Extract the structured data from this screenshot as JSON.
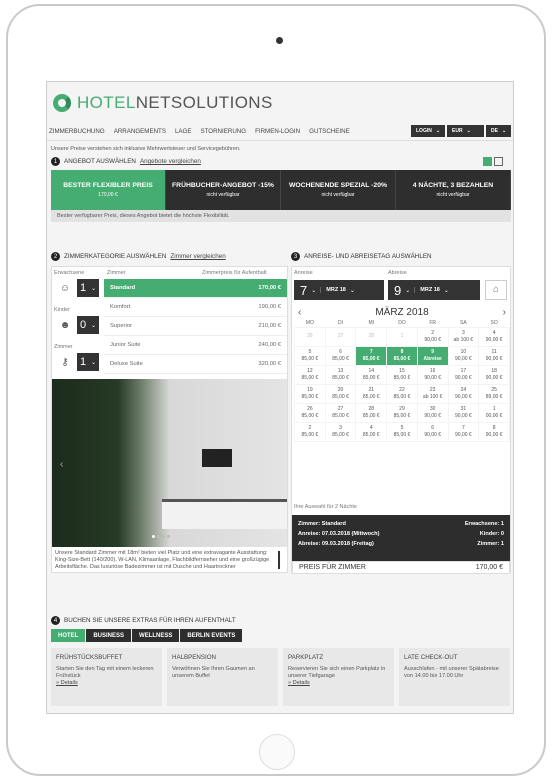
{
  "brand": {
    "part1": "HOTEL",
    "part2": "NETSOLUTIONS"
  },
  "nav": [
    "ZIMMERBUCHUNG",
    "ARRANGEMENTS",
    "LAGE",
    "STORNIERUNG",
    "FIRMEN-LOGIN",
    "GUTSCHEINE"
  ],
  "nav_right": [
    {
      "label": "LOGIN"
    },
    {
      "label": "EUR"
    },
    {
      "label": "DE"
    }
  ],
  "info": "Unsere Preise verstehen sich inklusive Mehrwertsteuer und Servicegebühren.",
  "step1": {
    "n": "1",
    "title": "ANGEBOT AUSWÄHLEN",
    "link": "Angebote vergleichen"
  },
  "offers": [
    {
      "title": "BESTER FLEXIBLER PREIS",
      "sub": "170,00 €"
    },
    {
      "title": "FRÜHBUCHER-ANGEBOT -15%",
      "sub": "nicht verfügbar"
    },
    {
      "title": "WOCHENENDE SPEZIAL -20%",
      "sub": "nicht verfügbar"
    },
    {
      "title": "4 NÄCHTE, 3 BEZAHLEN",
      "sub": "nicht verfügbar"
    }
  ],
  "offer_info": "Bester verfügbarer Preis, dieses Angebot bietet die höchste Flexibilität.",
  "step2": {
    "n": "2",
    "title": "ZIMMERKATEGORIE AUSWÄHLEN",
    "link": "Zimmer vergleichen"
  },
  "counters": {
    "adults_label": "Erwachsene",
    "adults": "1",
    "kids_label": "Kinder",
    "kids": "0",
    "rooms_label": "Zimmer",
    "rooms": "1"
  },
  "room_head": {
    "left": "Zimmer",
    "right": "Zimmerpreis für Aufenthalt"
  },
  "rooms": [
    {
      "name": "Standard",
      "price": "170,00 €"
    },
    {
      "name": "Komfort",
      "price": "190,00 €"
    },
    {
      "name": "Superior",
      "price": "210,00 €"
    },
    {
      "name": "Junior Suite",
      "price": "240,00 €"
    },
    {
      "name": "Deluxe Suite",
      "price": "320,00 €"
    }
  ],
  "room_desc": "Unsere Standard Zimmer mit 18m² bieten viel Platz und eine extravagante Ausstattung: King-Size-Bett (140/200), W-LAN, Klimaanlage, Flachbildfernseher und eine großzügige Arbeitsfläche. Das luxuriöse Badezimmer ist mit Dusche und Haartrockner",
  "step3": {
    "n": "3",
    "title": "ANREISE- UND ABREISETAG AUSWÄHLEN"
  },
  "dates": {
    "arr_label": "Anreise",
    "arr_day": "7",
    "arr_month": "MRZ 18",
    "dep_label": "Abreise",
    "dep_day": "9",
    "dep_month": "MRZ 18"
  },
  "calendar": {
    "prev": "‹",
    "next": "›",
    "month": "MÄRZ 2018",
    "dow": [
      "MO",
      "DI",
      "MI",
      "DO",
      "FR",
      "SA",
      "SO"
    ],
    "weeks": [
      [
        {
          "d": "26",
          "p": ""
        },
        {
          "d": "27",
          "p": ""
        },
        {
          "d": "28",
          "p": ""
        },
        {
          "d": "1",
          "p": ""
        },
        {
          "d": "2",
          "p": "90,00 €"
        },
        {
          "d": "3",
          "p": "ab 100 €"
        },
        {
          "d": "4",
          "p": "90,00 €"
        }
      ],
      [
        {
          "d": "5",
          "p": "85,00 €"
        },
        {
          "d": "6",
          "p": "85,00 €"
        },
        {
          "d": "7",
          "p": "85,00 €"
        },
        {
          "d": "8",
          "p": "85,00 €"
        },
        {
          "d": "9",
          "p": "Abreise"
        },
        {
          "d": "10",
          "p": "90,00 €"
        },
        {
          "d": "11",
          "p": "90,00 €"
        }
      ],
      [
        {
          "d": "12",
          "p": "85,00 €"
        },
        {
          "d": "13",
          "p": "85,00 €"
        },
        {
          "d": "14",
          "p": "85,00 €"
        },
        {
          "d": "15",
          "p": "85,00 €"
        },
        {
          "d": "16",
          "p": "90,00 €"
        },
        {
          "d": "17",
          "p": "90,00 €"
        },
        {
          "d": "18",
          "p": "90,00 €"
        }
      ],
      [
        {
          "d": "19",
          "p": "85,00 €"
        },
        {
          "d": "20",
          "p": "85,00 €"
        },
        {
          "d": "21",
          "p": "85,00 €"
        },
        {
          "d": "22",
          "p": "85,00 €"
        },
        {
          "d": "23",
          "p": "ab 100 €"
        },
        {
          "d": "24",
          "p": "90,00 €"
        },
        {
          "d": "25",
          "p": "89,00 €"
        }
      ],
      [
        {
          "d": "26",
          "p": "85,00 €"
        },
        {
          "d": "27",
          "p": "85,00 €"
        },
        {
          "d": "28",
          "p": "85,00 €"
        },
        {
          "d": "29",
          "p": "85,00 €"
        },
        {
          "d": "30",
          "p": "90,00 €"
        },
        {
          "d": "31",
          "p": "90,00 €"
        },
        {
          "d": "1",
          "p": "00,00 €"
        }
      ],
      [
        {
          "d": "2",
          "p": "85,00 €"
        },
        {
          "d": "3",
          "p": "85,00 €"
        },
        {
          "d": "4",
          "p": "85,00 €"
        },
        {
          "d": "5",
          "p": "85,00 €"
        },
        {
          "d": "6",
          "p": "90,00 €"
        },
        {
          "d": "7",
          "p": "90,00 €"
        },
        {
          "d": "8",
          "p": "90,00 €"
        }
      ]
    ]
  },
  "selection": {
    "label": "Ihre Auswahl für 2 Nächte",
    "zimmer": "Zimmer:  Standard",
    "erw": "Erwachsene: 1",
    "anreise": "Anreise:  07.03.2018 (Mittwoch)",
    "kinder": "Kinder: 0",
    "abreise": "Abreise:  09.03.2018 (Freitag)",
    "zimmer_n": "Zimmer: 1",
    "price_label": "PREIS FÜR ZIMMER",
    "price": "170,00 €"
  },
  "step4": {
    "n": "4",
    "title": "BUCHEN SIE UNSERE EXTRAS FÜR IHREN AUFENTHALT"
  },
  "extra_tabs": [
    "HOTEL",
    "BUSINESS",
    "WELLNESS",
    "BERLIN EVENTS"
  ],
  "extras": [
    {
      "title": "FRÜHSTÜCKSBUFFET",
      "text": "Starten Sie den Tag mit einem leckeren Frühstück",
      "link": "» Details"
    },
    {
      "title": "HALBPENSION",
      "text": "Verwöhnen Sie Ihren Gaumen an unserem Buffet",
      "link": ""
    },
    {
      "title": "PARKPLATZ",
      "text": "Reservieren Sie sich einen Parkplatz in unserer Tiefgarage",
      "link": "» Details"
    },
    {
      "title": "LATE CHECK-OUT",
      "text": "Ausschlafen - mit unserer Spätabreise von 14.00 bis 17.00 Uhr",
      "link": ""
    }
  ],
  "colors": {
    "accent": "#45ad72",
    "dark": "#2e2e2e"
  }
}
